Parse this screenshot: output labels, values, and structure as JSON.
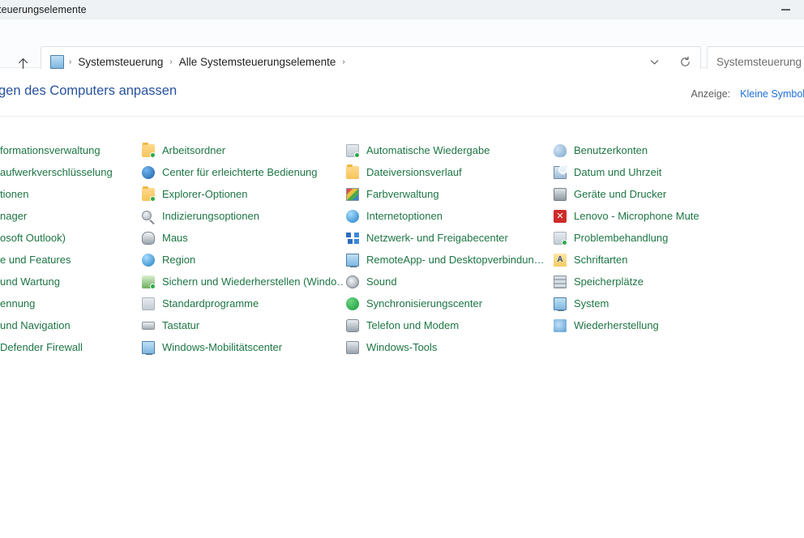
{
  "window": {
    "title": "teuerungselemente",
    "minimize_label": "Minimieren"
  },
  "navbar": {
    "up_tooltip": "Nach oben",
    "breadcrumbs": [
      "Systemsteuerung",
      "Alle Systemsteuerungselemente"
    ],
    "separator": "›",
    "history_dropdown": "chevron-down-icon",
    "refresh": "refresh-icon",
    "search_placeholder": "Systemsteuerung du"
  },
  "header": {
    "title": "gen des Computers anpassen",
    "view_label": "Anzeige:",
    "view_value": "Kleine Symbole"
  },
  "columns": [
    {
      "name": "column-1",
      "items": [
        {
          "label": "formationsverwaltung",
          "icon": "none"
        },
        {
          "label": "aufwerkverschlüsselung",
          "icon": "none"
        },
        {
          "label": "tionen",
          "icon": "none"
        },
        {
          "label": "nager",
          "icon": "none"
        },
        {
          "label": "osoft Outlook)",
          "icon": "none"
        },
        {
          "label": "e und Features",
          "icon": "none"
        },
        {
          "label": "und Wartung",
          "icon": "none"
        },
        {
          "label": "ennung",
          "icon": "none"
        },
        {
          "label": "und Navigation",
          "icon": "none"
        },
        {
          "label": "Defender Firewall",
          "icon": "none"
        }
      ]
    },
    {
      "name": "column-2",
      "items": [
        {
          "label": "Arbeitsordner",
          "icon": "folder"
        },
        {
          "label": "Center für erleichterte Bedienung",
          "icon": "circ-blue"
        },
        {
          "label": "Explorer-Optionen",
          "icon": "folder"
        },
        {
          "label": "Indizierungsoptionen",
          "icon": "search-mag"
        },
        {
          "label": "Maus",
          "icon": "mouse"
        },
        {
          "label": "Region",
          "icon": "circ-globe"
        },
        {
          "label": "Sichern und Wiederherstellen (Windo…)",
          "icon": "backup"
        },
        {
          "label": "Standardprogramme",
          "icon": "win-grey"
        },
        {
          "label": "Tastatur",
          "icon": "keyboard"
        },
        {
          "label": "Windows-Mobilitätscenter",
          "icon": "monitor"
        }
      ]
    },
    {
      "name": "column-3",
      "items": [
        {
          "label": "Automatische Wiedergabe",
          "icon": "win-grey"
        },
        {
          "label": "Dateiversionsverlauf",
          "icon": "folder"
        },
        {
          "label": "Farbverwaltung",
          "icon": "colorsq"
        },
        {
          "label": "Internetoptionen",
          "icon": "circ-globe"
        },
        {
          "label": "Netzwerk- und Freigabecenter",
          "icon": "netgrid"
        },
        {
          "label": "RemoteApp- und Desktopverbindun…",
          "icon": "monitor"
        },
        {
          "label": "Sound",
          "icon": "sound"
        },
        {
          "label": "Synchronisierungscenter",
          "icon": "circ-green"
        },
        {
          "label": "Telefon und Modem",
          "icon": "phone"
        },
        {
          "label": "Windows-Tools",
          "icon": "tools"
        }
      ]
    },
    {
      "name": "column-4",
      "items": [
        {
          "label": "Benutzerkonten",
          "icon": "people"
        },
        {
          "label": "Datum und Uhrzeit",
          "icon": "clock"
        },
        {
          "label": "Geräte und Drucker",
          "icon": "printer"
        },
        {
          "label": "Lenovo - Microphone Mute",
          "icon": "red-x"
        },
        {
          "label": "Problembehandlung",
          "icon": "win-grey"
        },
        {
          "label": "Schriftarten",
          "icon": "fontA"
        },
        {
          "label": "Speicherplätze",
          "icon": "stack"
        },
        {
          "label": "System",
          "icon": "monitor"
        },
        {
          "label": "Wiederherstellung",
          "icon": "recovery"
        }
      ]
    }
  ],
  "colors": {
    "item_text": "#1d7544",
    "title_text": "#28539e",
    "link": "#1e6fd9",
    "titlebar_bg": "#eef2f5",
    "accent_red": "#cf2a2a"
  }
}
